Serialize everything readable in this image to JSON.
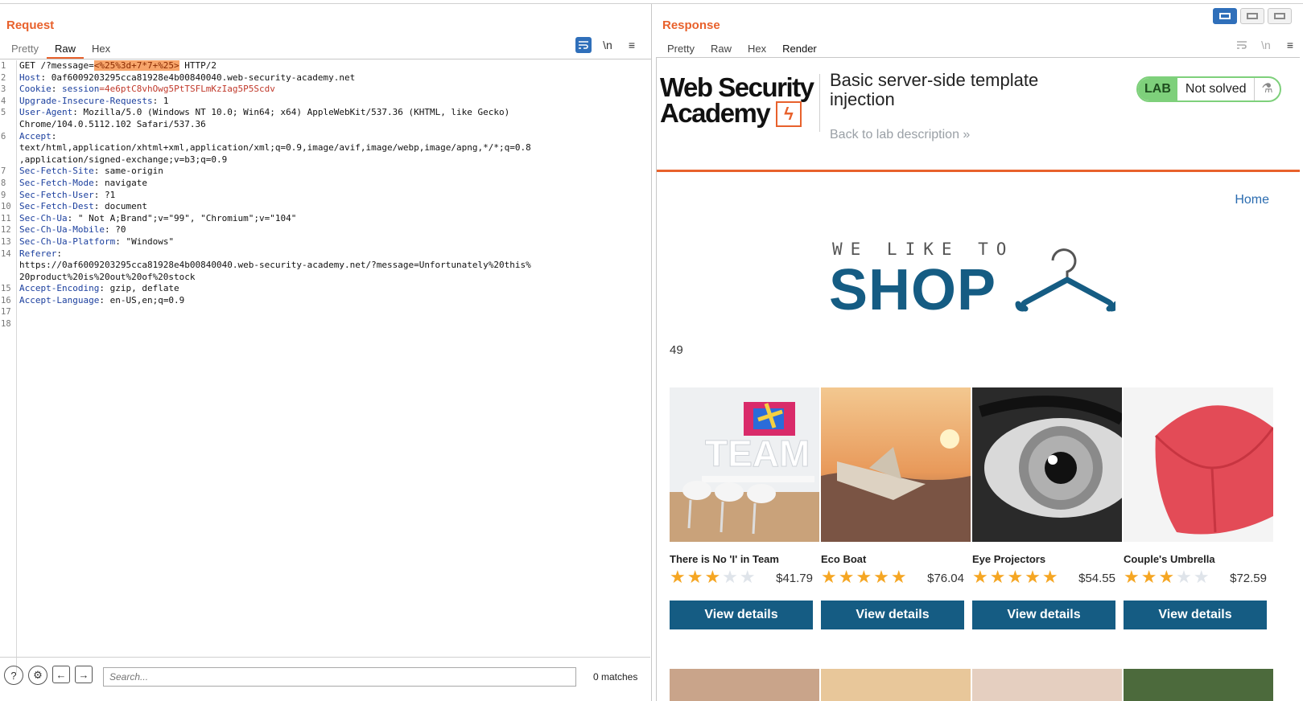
{
  "request": {
    "title": "Request",
    "tabs": [
      "Pretty",
      "Raw",
      "Hex"
    ],
    "tools": {
      "wrap": "wrap-icon",
      "newline": "\\n",
      "menu": "≡"
    },
    "line_numbers": [
      "1",
      "2",
      "3",
      "4",
      "5",
      "",
      "6",
      "",
      "",
      "7",
      "8",
      "9",
      "10",
      "11",
      "12",
      "13",
      "14",
      "",
      "",
      "15",
      "16",
      "17",
      "18"
    ],
    "lines": {
      "l1_pre": "GET /?message=",
      "l1_hl": "<%25%3d+7*7+%25>",
      "l1_post": " HTTP/2",
      "l2_key": "Host",
      "l2_val": ": 0af6009203295cca81928e4b00840040.web-security-academy.net",
      "l3_key": "Cookie",
      "l3_sep": ": ",
      "l3_ck": "session",
      "l3_cv": "=4e6ptC8vhOwg5PtTSFLmKzIag5P5Scdv",
      "l4_key": "Upgrade-Insecure-Requests",
      "l4_val": ": 1",
      "l5_key": "User-Agent",
      "l5_val": ": Mozilla/5.0 (Windows NT 10.0; Win64; x64) AppleWebKit/537.36 (KHTML, like Gecko)",
      "l5b": "Chrome/104.0.5112.102 Safari/537.36",
      "l6_key": "Accept",
      "l6_val": ":",
      "l6b": "text/html,application/xhtml+xml,application/xml;q=0.9,image/avif,image/webp,image/apng,*/*;q=0.8",
      "l6c": ",application/signed-exchange;v=b3;q=0.9",
      "l7_key": "Sec-Fetch-Site",
      "l7_val": ": same-origin",
      "l8_key": "Sec-Fetch-Mode",
      "l8_val": ": navigate",
      "l9_key": "Sec-Fetch-User",
      "l9_val": ": ?1",
      "l10_key": "Sec-Fetch-Dest",
      "l10_val": ": document",
      "l11_key": "Sec-Ch-Ua",
      "l11_val": ": \" Not A;Brand\";v=\"99\", \"Chromium\";v=\"104\"",
      "l12_key": "Sec-Ch-Ua-Mobile",
      "l12_val": ": ?0",
      "l13_key": "Sec-Ch-Ua-Platform",
      "l13_val": ": \"Windows\"",
      "l14_key": "Referer",
      "l14_val": ":",
      "l14b": "https://0af6009203295cca81928e4b00840040.web-security-academy.net/?message=Unfortunately%20this%",
      "l14c": "20product%20is%20out%20of%20stock",
      "l15_key": "Accept-Encoding",
      "l15_val": ": gzip, deflate",
      "l16_key": "Accept-Language",
      "l16_val": ": en-US,en;q=0.9"
    },
    "footer": {
      "search_placeholder": "Search...",
      "matches": "0 matches",
      "help": "?",
      "settings": "⚙",
      "back": "←",
      "forward": "→"
    }
  },
  "response": {
    "title": "Response",
    "tabs": [
      "Pretty",
      "Raw",
      "Hex",
      "Render"
    ],
    "render": {
      "academy_line1": "Web Security",
      "academy_line2": "Academy",
      "lab_title": "Basic server-side template injection",
      "back_link": "Back to lab description »",
      "lab_badge": "LAB",
      "lab_status": "Not solved",
      "home_link": "Home",
      "shop_tagline": "WE LIKE TO",
      "shop_word": "SHOP",
      "message_output": "49",
      "products": [
        {
          "name": "There is No 'I' in Team",
          "rating": 3,
          "price": "$41.79",
          "button": "View details"
        },
        {
          "name": "Eco Boat",
          "rating": 5,
          "price": "$76.04",
          "button": "View details"
        },
        {
          "name": "Eye Projectors",
          "rating": 5,
          "price": "$54.55",
          "button": "View details"
        },
        {
          "name": "Couple's Umbrella",
          "rating": 3,
          "price": "$72.59",
          "button": "View details"
        }
      ]
    }
  },
  "colors": {
    "accent": "#e8612c",
    "shop_blue": "#155c83",
    "lab_green": "#7ed07b",
    "star": "#f5a623"
  }
}
